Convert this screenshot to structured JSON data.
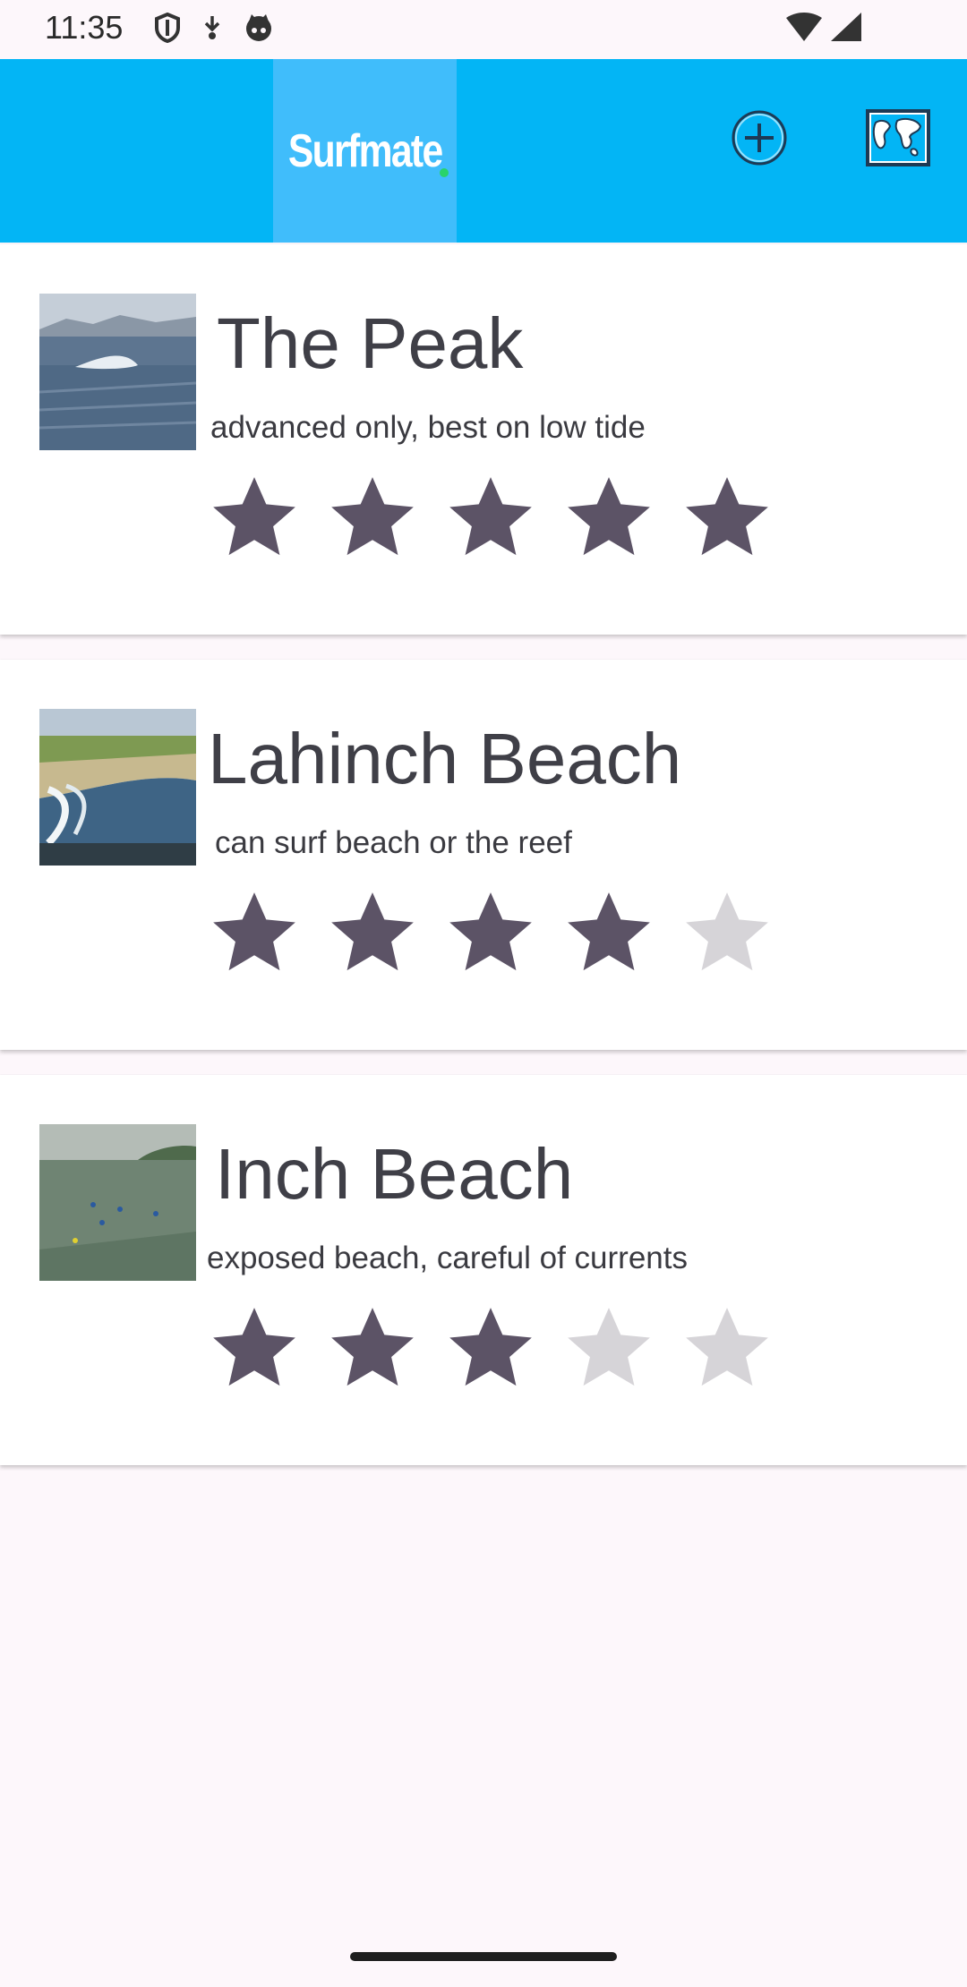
{
  "status_bar": {
    "time": "11:35",
    "left_icons": [
      "shield-icon",
      "download-icon",
      "cat-icon"
    ],
    "right_icons": [
      "wifi-icon",
      "signal-icon"
    ]
  },
  "app_bar": {
    "logo_text": "Surfmate",
    "background_color": "#03b5f5",
    "actions": [
      "add-circle-icon",
      "world-map-icon"
    ]
  },
  "spots": [
    {
      "name": "The Peak",
      "description": "advanced only, best on low tide",
      "rating": 5,
      "max_rating": 5
    },
    {
      "name": "Lahinch Beach",
      "description": "can surf beach or the reef",
      "rating": 4,
      "max_rating": 5
    },
    {
      "name": "Inch Beach",
      "description": "exposed beach, careful of currents",
      "rating": 3,
      "max_rating": 5
    }
  ],
  "colors": {
    "star_filled": "#5c5366",
    "star_empty": "#d6d4d8"
  }
}
